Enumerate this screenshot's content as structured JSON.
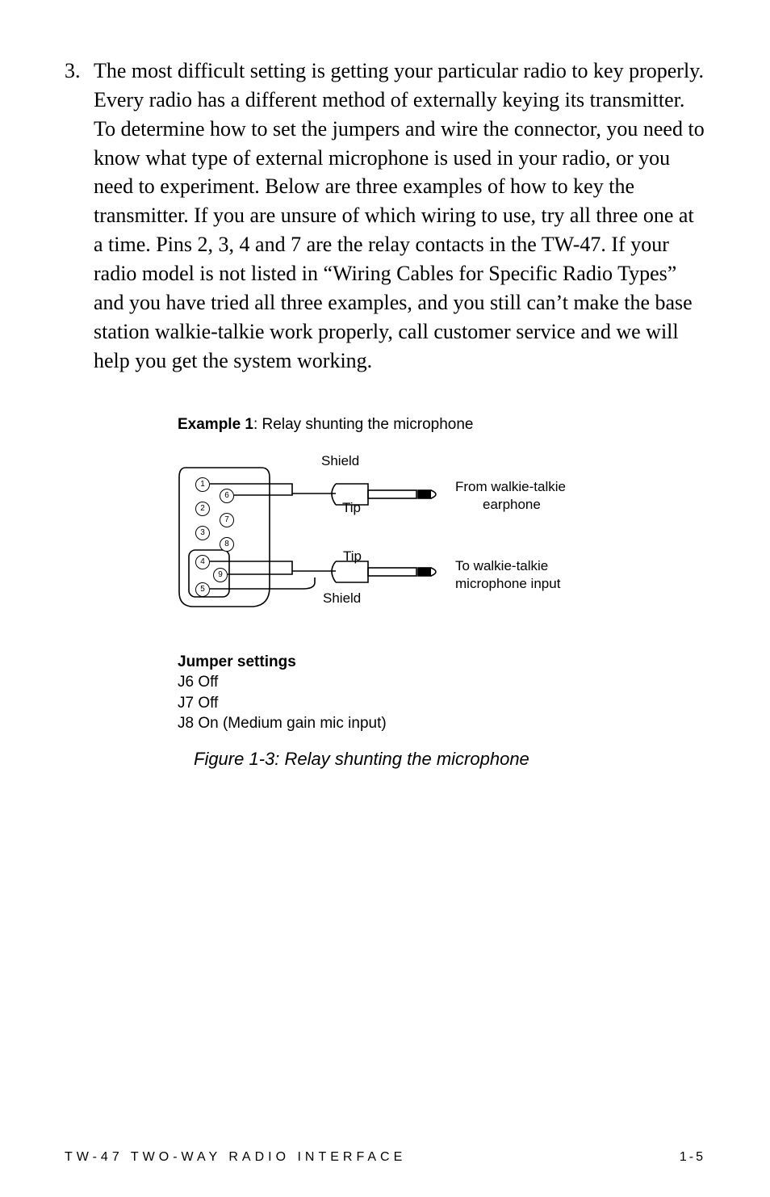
{
  "para": {
    "num": "3.",
    "text": "The most difficult setting is getting your particular radio to key properly. Every radio has a different method of externally keying its transmitter. To determine how to set the jumpers and wire the connector, you need to know what type of external microphone is used in your radio, or you need to experiment. Below are three examples of how to key the transmitter. If you are unsure of which wiring to use, try all three one at a time. Pins 2, 3, 4 and 7 are the relay contacts in the TW-47. If your radio model is not listed in “Wiring Cables for Specific Radio Types” and you have tried all three examples, and you still can’t make the base station walkie-talkie work properly, call customer service and we will help you get the system working."
  },
  "example": {
    "label_bold": "Example 1",
    "label_rest": ": Relay shunting the microphone"
  },
  "diagram": {
    "pins": [
      "1",
      "2",
      "3",
      "4",
      "5",
      "6",
      "7",
      "8",
      "9"
    ],
    "top": {
      "shield": "Shield",
      "tip": "Tip",
      "right1": "From walkie-talkie",
      "right2": "earphone"
    },
    "bottom": {
      "tip": "Tip",
      "shield": "Shield",
      "right1": "To walkie-talkie",
      "right2": "microphone input"
    }
  },
  "jumper": {
    "heading": "Jumper settings",
    "l1": "J6 Off",
    "l2": "J7 Off",
    "l3": "J8 On (Medium gain mic input)"
  },
  "figcap": "Figure 1-3: Relay shunting the microphone",
  "footer": {
    "left": "TW-47 TWO-WAY RADIO INTERFACE",
    "right": "1-5"
  }
}
